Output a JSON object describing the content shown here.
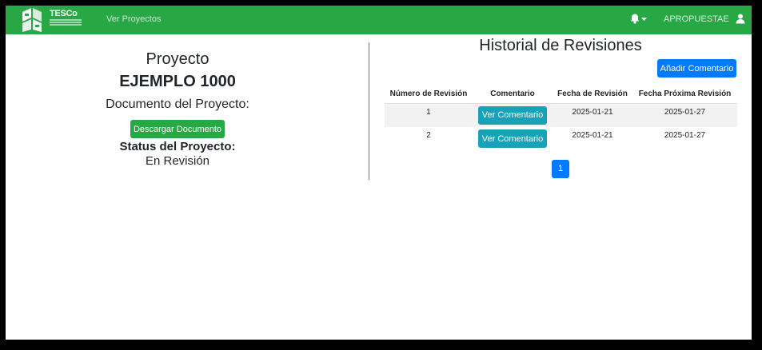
{
  "navbar": {
    "brand_text": "TESCo",
    "link": "Ver Proyectos",
    "username": "APROPUESTAE",
    "accent": "#28a745",
    "icons": [
      "logo",
      "bell-icon",
      "caret-down-icon",
      "user-icon"
    ]
  },
  "project": {
    "heading": "Proyecto",
    "name": "EJEMPLO 1000",
    "doc_label": "Documento del Proyecto:",
    "download_label": "Descargar Documento",
    "status_label": "Status del Proyecto:",
    "status_value": "En Revisión"
  },
  "history": {
    "title": "Historial de Revisiones",
    "add_comment_label": "Añadir Comentario",
    "columns": [
      "Número de Revisión",
      "Comentario",
      "Fecha de Revisión",
      "Fecha Próxima Revisión"
    ],
    "rows": [
      {
        "num": "1",
        "button": "Ver Comentario",
        "date": "2025-01-21",
        "next": "2025-01-27"
      },
      {
        "num": "2",
        "button": "Ver Comentario",
        "date": "2025-01-21",
        "next": "2025-01-27"
      }
    ],
    "next_date_color": "#ffc107"
  },
  "pagination": {
    "current": "1",
    "color": "#007bff"
  }
}
